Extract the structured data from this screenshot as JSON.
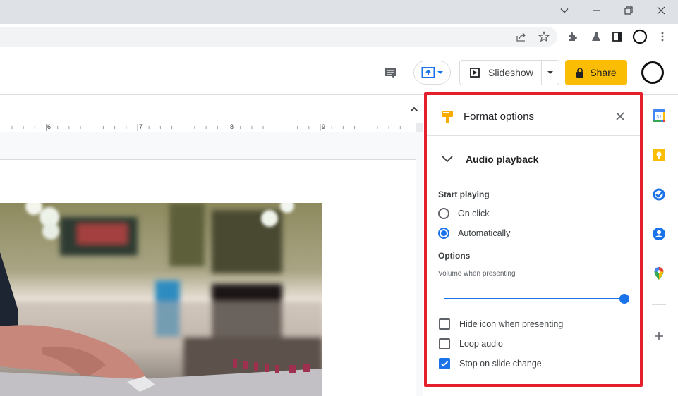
{
  "browser": {
    "window_controls": [
      "tab-search",
      "minimize",
      "restore",
      "close"
    ],
    "toolbar_icons": [
      "share-icon",
      "bookmark-star-icon",
      "extensions-icon",
      "labs-icon",
      "side-panel-icon",
      "profile-icon",
      "menu-icon"
    ]
  },
  "header": {
    "comments_icon": "comment-icon",
    "present_icon": "present-to-meet-icon",
    "slideshow_label": "Slideshow",
    "share_label": "Share"
  },
  "ruler": {
    "ticks": [
      "6",
      "7",
      "8",
      "9"
    ]
  },
  "format_panel": {
    "title": "Format options",
    "section_title": "Audio playback",
    "start_playing_label": "Start playing",
    "start_options": [
      {
        "label": "On click",
        "selected": false
      },
      {
        "label": "Automatically",
        "selected": true
      }
    ],
    "options_label": "Options",
    "volume_label": "Volume when presenting",
    "volume_value": 1.0,
    "checkboxes": [
      {
        "label": "Hide icon when presenting",
        "checked": false
      },
      {
        "label": "Loop audio",
        "checked": false
      },
      {
        "label": "Stop on slide change",
        "checked": true
      }
    ]
  },
  "side_apps": [
    "calendar",
    "keep",
    "tasks",
    "contacts",
    "maps"
  ],
  "colors": {
    "accent": "#1a73e8",
    "share": "#fbbc04",
    "highlight": "#e3202b"
  }
}
